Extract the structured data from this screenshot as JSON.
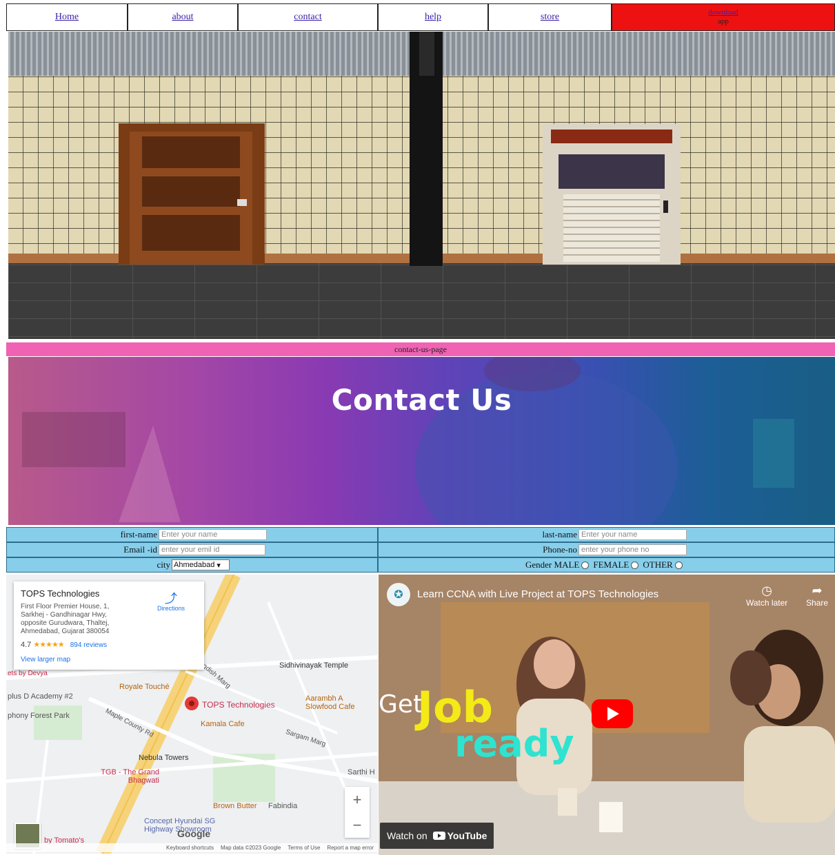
{
  "nav": {
    "items": [
      "Home",
      "about",
      "contact",
      "help",
      "store"
    ],
    "download_label": "download",
    "download_sub": "app"
  },
  "pinkbar": {
    "text": "contact-us-page"
  },
  "banner": {
    "title": "Contact Us"
  },
  "form": {
    "first_name_label": "first-name",
    "first_name_placeholder": "Enter your name",
    "last_name_label": "last-name",
    "last_name_placeholder": "Enter your name",
    "email_label": "Email -id",
    "email_placeholder": "enter your emil id",
    "phone_label": "Phone-no",
    "phone_placeholder": "enter your phone no",
    "city_label": "city",
    "city_value": "Ahmedabad",
    "gender_label": "Gender",
    "gender_options": [
      "MALE",
      "FEMALE",
      "OTHER"
    ]
  },
  "map": {
    "place_title": "TOPS Technologies",
    "address": "First Floor Premier House, 1, Sarkhej - Gandhinagar Hwy, opposite Gurudwara, Thaltej, Ahmedabad, Gujarat 380054",
    "rating": "4.7",
    "stars": "★★★★★",
    "reviews": "894 reviews",
    "view_larger": "View larger map",
    "directions": "Directions",
    "labels": {
      "sidhivinayak": "Sidhivinayak Temple",
      "royale": "Royale Touché",
      "tops": "TOPS Technologies",
      "aarambh": "Aarambh A Slowfood Cafe",
      "kamala": "Kamala Cafe",
      "dacademy": "plus D Academy #2",
      "symphony": "phony Forest Park",
      "nebula": "Nebula Towers",
      "tgb": "TGB - The Grand Bhagwati",
      "brown": "Brown Butter",
      "fabindia": "Fabindia",
      "concept": "Concept Hyundai SG Highway Showroom",
      "tomato": "by Tomato's",
      "sarthi": "Sarthi H",
      "devya": "ets by Devya",
      "maple": "Maple County Rd",
      "sargam": "Sargam Marg",
      "jagdish": "gdish Marg"
    },
    "footer": [
      "Keyboard shortcuts",
      "Map data ©2023 Google",
      "Terms of Use",
      "Report a map error"
    ],
    "google": "Google"
  },
  "video": {
    "title": "Learn CCNA with Live Project at TOPS Technologies",
    "watch_later": "Watch later",
    "share": "Share",
    "get": "Get",
    "job": "Job",
    "ready": "ready",
    "watch_on": "Watch on",
    "youtube": "YouTube"
  }
}
